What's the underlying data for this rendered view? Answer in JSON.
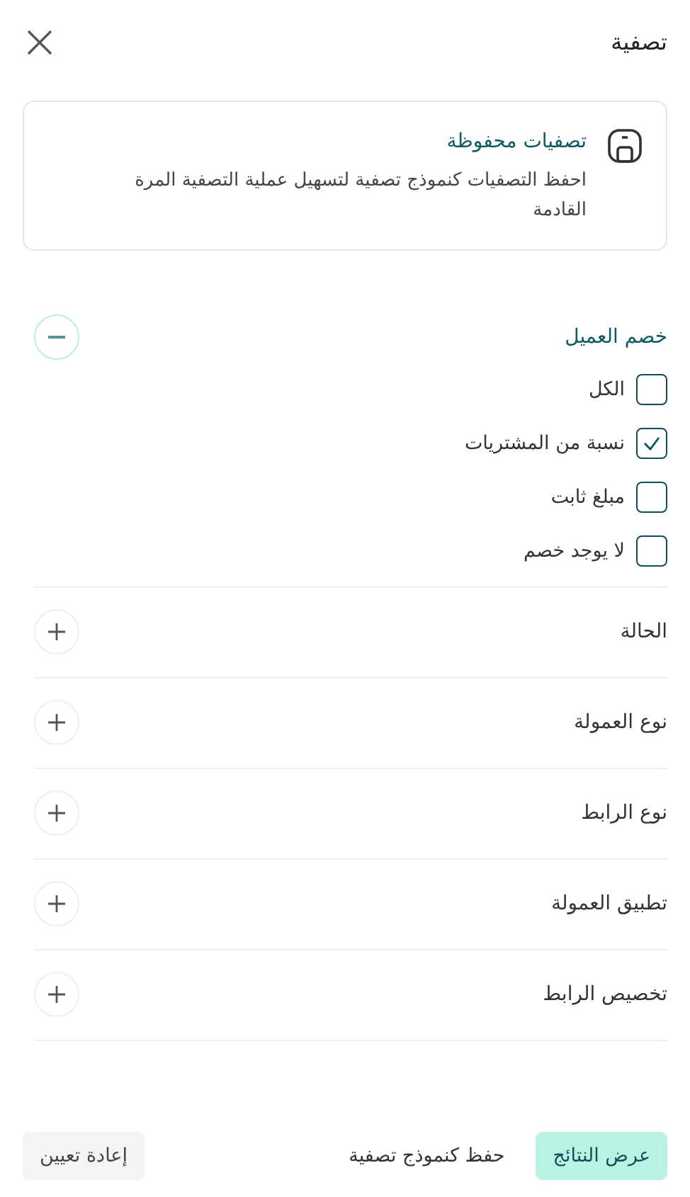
{
  "header": {
    "title": "تصفية"
  },
  "saved_filters": {
    "title": "تصفيات محفوظة",
    "description": "احفظ التصفيات كنموذج تصفية لتسهيل عملية التصفية المرة القادمة"
  },
  "sections": [
    {
      "title": "خصم العميل",
      "expanded": true,
      "options": [
        {
          "label": "الكل",
          "checked": false
        },
        {
          "label": "نسبة من المشتريات",
          "checked": true
        },
        {
          "label": "مبلغ ثابت",
          "checked": false
        },
        {
          "label": "لا يوجد خصم",
          "checked": false
        }
      ]
    },
    {
      "title": "الحالة",
      "expanded": false
    },
    {
      "title": "نوع العمولة",
      "expanded": false
    },
    {
      "title": "نوع الرابط",
      "expanded": false
    },
    {
      "title": "تطبيق العمولة",
      "expanded": false
    },
    {
      "title": "تخصيص الرابط",
      "expanded": false
    }
  ],
  "footer": {
    "buttons": [
      {
        "label": "عرض النتائج",
        "kind": "primary"
      },
      {
        "label": "حفظ كنموذج تصفية",
        "kind": "link"
      },
      {
        "label": "إعادة تعيين",
        "kind": "secondary"
      }
    ]
  }
}
